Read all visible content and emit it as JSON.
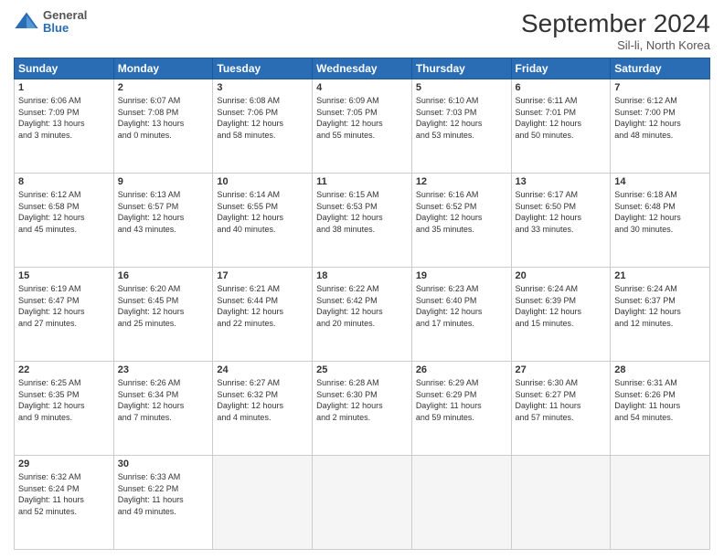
{
  "header": {
    "logo": {
      "general": "General",
      "blue": "Blue"
    },
    "title": "September 2024",
    "location": "Sil-li, North Korea"
  },
  "weekdays": [
    "Sunday",
    "Monday",
    "Tuesday",
    "Wednesday",
    "Thursday",
    "Friday",
    "Saturday"
  ],
  "weeks": [
    [
      {
        "day": "1",
        "sunrise": "6:06 AM",
        "sunset": "7:09 PM",
        "daylight": "13 hours and 3 minutes"
      },
      {
        "day": "2",
        "sunrise": "6:07 AM",
        "sunset": "7:08 PM",
        "daylight": "13 hours and 0 minutes"
      },
      {
        "day": "3",
        "sunrise": "6:08 AM",
        "sunset": "7:06 PM",
        "daylight": "12 hours and 58 minutes"
      },
      {
        "day": "4",
        "sunrise": "6:09 AM",
        "sunset": "7:05 PM",
        "daylight": "12 hours and 55 minutes"
      },
      {
        "day": "5",
        "sunrise": "6:10 AM",
        "sunset": "7:03 PM",
        "daylight": "12 hours and 53 minutes"
      },
      {
        "day": "6",
        "sunrise": "6:11 AM",
        "sunset": "7:01 PM",
        "daylight": "12 hours and 50 minutes"
      },
      {
        "day": "7",
        "sunrise": "6:12 AM",
        "sunset": "7:00 PM",
        "daylight": "12 hours and 48 minutes"
      }
    ],
    [
      {
        "day": "8",
        "sunrise": "6:12 AM",
        "sunset": "6:58 PM",
        "daylight": "12 hours and 45 minutes"
      },
      {
        "day": "9",
        "sunrise": "6:13 AM",
        "sunset": "6:57 PM",
        "daylight": "12 hours and 43 minutes"
      },
      {
        "day": "10",
        "sunrise": "6:14 AM",
        "sunset": "6:55 PM",
        "daylight": "12 hours and 40 minutes"
      },
      {
        "day": "11",
        "sunrise": "6:15 AM",
        "sunset": "6:53 PM",
        "daylight": "12 hours and 38 minutes"
      },
      {
        "day": "12",
        "sunrise": "6:16 AM",
        "sunset": "6:52 PM",
        "daylight": "12 hours and 35 minutes"
      },
      {
        "day": "13",
        "sunrise": "6:17 AM",
        "sunset": "6:50 PM",
        "daylight": "12 hours and 33 minutes"
      },
      {
        "day": "14",
        "sunrise": "6:18 AM",
        "sunset": "6:48 PM",
        "daylight": "12 hours and 30 minutes"
      }
    ],
    [
      {
        "day": "15",
        "sunrise": "6:19 AM",
        "sunset": "6:47 PM",
        "daylight": "12 hours and 27 minutes"
      },
      {
        "day": "16",
        "sunrise": "6:20 AM",
        "sunset": "6:45 PM",
        "daylight": "12 hours and 25 minutes"
      },
      {
        "day": "17",
        "sunrise": "6:21 AM",
        "sunset": "6:44 PM",
        "daylight": "12 hours and 22 minutes"
      },
      {
        "day": "18",
        "sunrise": "6:22 AM",
        "sunset": "6:42 PM",
        "daylight": "12 hours and 20 minutes"
      },
      {
        "day": "19",
        "sunrise": "6:23 AM",
        "sunset": "6:40 PM",
        "daylight": "12 hours and 17 minutes"
      },
      {
        "day": "20",
        "sunrise": "6:24 AM",
        "sunset": "6:39 PM",
        "daylight": "12 hours and 15 minutes"
      },
      {
        "day": "21",
        "sunrise": "6:24 AM",
        "sunset": "6:37 PM",
        "daylight": "12 hours and 12 minutes"
      }
    ],
    [
      {
        "day": "22",
        "sunrise": "6:25 AM",
        "sunset": "6:35 PM",
        "daylight": "12 hours and 9 minutes"
      },
      {
        "day": "23",
        "sunrise": "6:26 AM",
        "sunset": "6:34 PM",
        "daylight": "12 hours and 7 minutes"
      },
      {
        "day": "24",
        "sunrise": "6:27 AM",
        "sunset": "6:32 PM",
        "daylight": "12 hours and 4 minutes"
      },
      {
        "day": "25",
        "sunrise": "6:28 AM",
        "sunset": "6:30 PM",
        "daylight": "12 hours and 2 minutes"
      },
      {
        "day": "26",
        "sunrise": "6:29 AM",
        "sunset": "6:29 PM",
        "daylight": "11 hours and 59 minutes"
      },
      {
        "day": "27",
        "sunrise": "6:30 AM",
        "sunset": "6:27 PM",
        "daylight": "11 hours and 57 minutes"
      },
      {
        "day": "28",
        "sunrise": "6:31 AM",
        "sunset": "6:26 PM",
        "daylight": "11 hours and 54 minutes"
      }
    ],
    [
      {
        "day": "29",
        "sunrise": "6:32 AM",
        "sunset": "6:24 PM",
        "daylight": "11 hours and 52 minutes"
      },
      {
        "day": "30",
        "sunrise": "6:33 AM",
        "sunset": "6:22 PM",
        "daylight": "11 hours and 49 minutes"
      },
      null,
      null,
      null,
      null,
      null
    ]
  ]
}
